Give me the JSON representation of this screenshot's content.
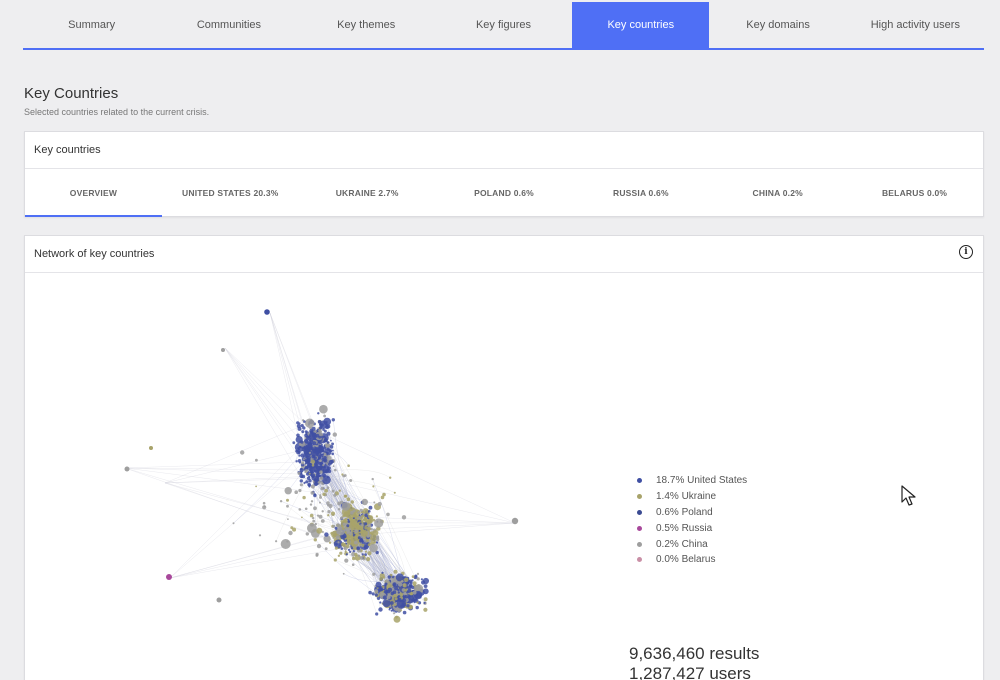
{
  "nav": {
    "tabs": [
      "Summary",
      "Communities",
      "Key themes",
      "Key figures",
      "Key countries",
      "Key domains",
      "High activity users"
    ],
    "active_index": 4
  },
  "page": {
    "title": "Key Countries",
    "subtitle": "Selected countries related to the current crisis."
  },
  "key_countries_card": {
    "header": "Key countries",
    "tabs": [
      "OVERVIEW",
      "UNITED STATES 20.3%",
      "UKRAINE 2.7%",
      "POLAND 0.6%",
      "RUSSIA 0.6%",
      "CHINA 0.2%",
      "BELARUS 0.0%"
    ],
    "active_index": 0
  },
  "network_card": {
    "header": "Network of key countries",
    "info_icon": "info-circle-icon",
    "legend": [
      {
        "label": "18.7% United States",
        "color": "#3f4fa3"
      },
      {
        "label": "1.4% Ukraine",
        "color": "#a8a36a"
      },
      {
        "label": "0.6% Poland",
        "color": "#3a4a92"
      },
      {
        "label": "0.5% Russia",
        "color": "#a8489b"
      },
      {
        "label": "0.2% China",
        "color": "#9e9e9e"
      },
      {
        "label": "0.0% Belarus",
        "color": "#c98fa6"
      }
    ],
    "results": "9,636,460 results",
    "users": "1,287,427 users"
  },
  "colors": {
    "accent": "#4f6ff5",
    "node_blue": "#3f4fa3",
    "node_olive": "#a8a36a",
    "node_gray": "#9e9e9e",
    "node_purple": "#a8489b"
  }
}
